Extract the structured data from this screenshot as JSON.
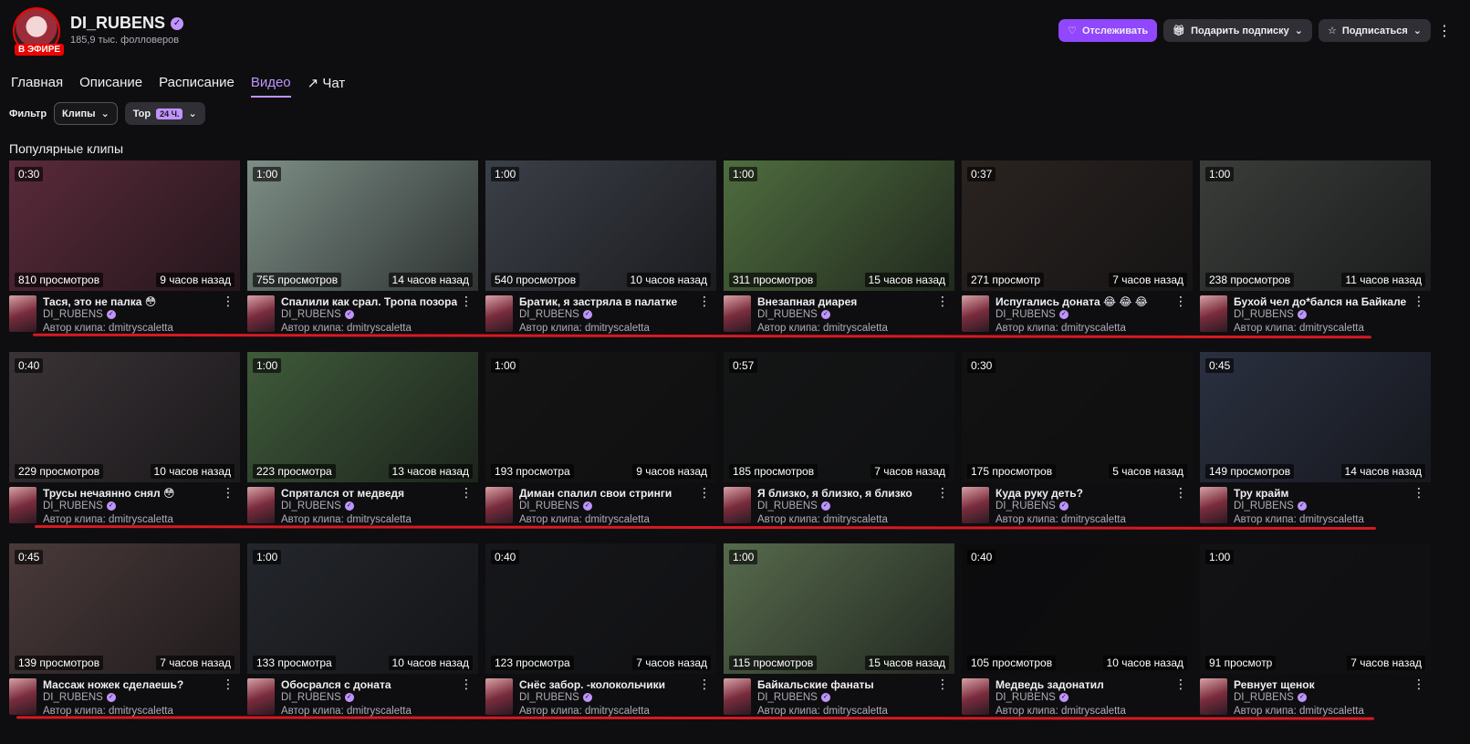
{
  "channel": {
    "name": "DI_RUBENS",
    "followers": "185,9 тыс. фолловеров",
    "live_badge": "В ЭФИРЕ"
  },
  "header_buttons": {
    "follow": "Отслеживать",
    "gift": "Подарить подписку",
    "subscribe": "Подписаться"
  },
  "tabs": [
    "Главная",
    "Описание",
    "Расписание",
    "Видео",
    "Чат"
  ],
  "filter": {
    "label": "Фильтр",
    "type": "Клипы",
    "sort": "Top",
    "range": "24 Ч."
  },
  "section_title": "Популярные клипы",
  "author_prefix": "Автор клипа: dmitryscaletta",
  "clips": [
    {
      "title": "Тася, это не палка 😳",
      "duration": "0:30",
      "views": "810 просмотров",
      "ago": "9 часов назад",
      "bg": "#5a2a3a"
    },
    {
      "title": "Спалили как срал. Тропа позора",
      "duration": "1:00",
      "views": "755 просмотров",
      "ago": "14 часов назад",
      "bg": "#7d8e86"
    },
    {
      "title": "Братик, я застряла в палатке",
      "duration": "1:00",
      "views": "540 просмотров",
      "ago": "10 часов назад",
      "bg": "#3b3f47"
    },
    {
      "title": "Внезапная диарея",
      "duration": "1:00",
      "views": "311 просмотров",
      "ago": "15 часов назад",
      "bg": "#4f6d3f"
    },
    {
      "title": "Испугались доната 😂 😂 😂",
      "duration": "0:37",
      "views": "271 просмотр",
      "ago": "7 часов назад",
      "bg": "#2a2320"
    },
    {
      "title": "Бухой чел до*бался на Байкале",
      "duration": "1:00",
      "views": "238 просмотров",
      "ago": "11 часов назад",
      "bg": "#3a3d3a"
    },
    {
      "title": "Трусы нечаянно снял 😳",
      "duration": "0:40",
      "views": "229 просмотров",
      "ago": "10 часов назад",
      "bg": "#3a3336"
    },
    {
      "title": "Спрятался от медведя",
      "duration": "1:00",
      "views": "223 просмотра",
      "ago": "13 часов назад",
      "bg": "#3f5a3a"
    },
    {
      "title": "Диман спалил свои стринги",
      "duration": "1:00",
      "views": "193 просмотра",
      "ago": "9 часов назад",
      "bg": "#141414"
    },
    {
      "title": "Я близко, я близко, я близко",
      "duration": "0:57",
      "views": "185 просмотров",
      "ago": "7 часов назад",
      "bg": "#141616"
    },
    {
      "title": "Куда руку деть?",
      "duration": "0:30",
      "views": "175 просмотров",
      "ago": "5 часов назад",
      "bg": "#121212"
    },
    {
      "title": "Тру крайм",
      "duration": "0:45",
      "views": "149 просмотров",
      "ago": "14 часов назад",
      "bg": "#2a3040"
    },
    {
      "title": "Массаж ножек сделаешь?",
      "duration": "0:45",
      "views": "139 просмотров",
      "ago": "7 часов назад",
      "bg": "#4a3a3a"
    },
    {
      "title": "Обосрался с доната",
      "duration": "1:00",
      "views": "133 просмотра",
      "ago": "10 часов назад",
      "bg": "#23262b"
    },
    {
      "title": "Снёс забор. -колокольчики",
      "duration": "0:40",
      "views": "123 просмотра",
      "ago": "7 часов назад",
      "bg": "#16171a"
    },
    {
      "title": "Байкальские фанаты",
      "duration": "1:00",
      "views": "115 просмотров",
      "ago": "15 часов назад",
      "bg": "#566a4c"
    },
    {
      "title": "Медведь задонатил",
      "duration": "0:40",
      "views": "105 просмотров",
      "ago": "10 часов назад",
      "bg": "#0c0c0d"
    },
    {
      "title": "Ревнует щенок",
      "duration": "1:00",
      "views": "91 просмотр",
      "ago": "7 часов назад",
      "bg": "#121214"
    }
  ],
  "colors": {
    "accent": "#9147ff",
    "accent_light": "#bf94ff",
    "live": "#eb0400",
    "annotation_red": "#d71921",
    "background": "#0e0e10"
  }
}
